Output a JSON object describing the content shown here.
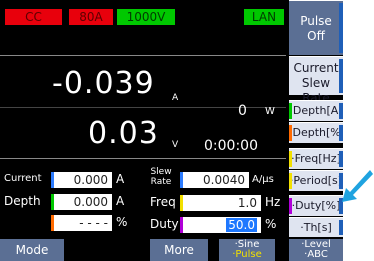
{
  "status": {
    "cc": "CC",
    "current_range": "80A",
    "voltage_range": "1000V",
    "lan": "LAN",
    "colors": {
      "red": "#e8000c",
      "green": "#00c800"
    }
  },
  "softkeys": {
    "pulse": {
      "line1": "Pulse",
      "line2": "Off"
    },
    "current_slew": {
      "line1": "Current",
      "line2": "Slew Rate"
    },
    "depth_a": "·Depth[A]",
    "depth_pct": "·Depth[%]",
    "freq": "·Freq[Hz]",
    "period": "·Period[s]",
    "duty": "·Duty[%]",
    "th": "·Th[s]"
  },
  "measurement": {
    "current_value": "-0.039",
    "current_unit": "A",
    "voltage_value": "0.03",
    "voltage_unit": "V",
    "power_value": "0",
    "power_unit": "W",
    "time": "0:00:00"
  },
  "settings": {
    "current_label": "Current",
    "current_value": "0.000",
    "current_unit": "A",
    "depth_label": "Depth",
    "depth_value": "0.000",
    "depth_unit": "A",
    "pct_value": "- - - -",
    "pct_unit": "%",
    "slew_label_1": "Slew",
    "slew_label_2": "Rate",
    "slew_value": "0.0040",
    "slew_unit": "A/µs",
    "freq_label": "Freq",
    "freq_value": "1.0",
    "freq_unit": "Hz",
    "duty_label": "Duty",
    "duty_value": "50.0",
    "duty_unit": "%"
  },
  "bottom_menu": {
    "mode": "Mode",
    "more": "More",
    "sine_1": "·Sine",
    "sine_2": "·Pulse",
    "level_1": "·Level",
    "level_2": "·ABC"
  }
}
